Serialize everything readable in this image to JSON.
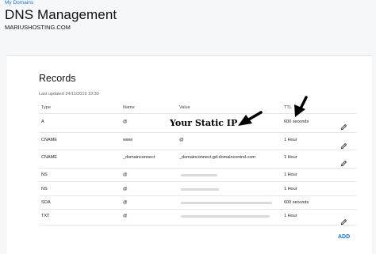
{
  "breadcrumb": "My Domains",
  "title": "DNS Management",
  "domain": "MARIUSHOSTING.COM",
  "records": {
    "heading": "Records",
    "last_updated": "Last updated 24/11/2019 19:30",
    "columns": {
      "type": "Type",
      "name": "Name",
      "value": "Value",
      "ttl": "TTL"
    },
    "rows": [
      {
        "type": "A",
        "name": "@",
        "value": "",
        "ttl": "600 seconds",
        "editable": true
      },
      {
        "type": "CNAME",
        "name": "www",
        "value": "@",
        "ttl": "1 Hour",
        "editable": true
      },
      {
        "type": "CNAME",
        "name": "_domainconnect",
        "value": "_domainconnect.gd.domaincontrol.com",
        "ttl": "1 Hour",
        "editable": true
      },
      {
        "type": "NS",
        "name": "@",
        "value": "",
        "ttl": "1 Hour",
        "editable": false
      },
      {
        "type": "NS",
        "name": "@",
        "value": "",
        "ttl": "1 Hour",
        "editable": false
      },
      {
        "type": "SOA",
        "name": "@",
        "value": "",
        "ttl": "600 seconds",
        "editable": false
      },
      {
        "type": "TXT",
        "name": "@",
        "value": "",
        "ttl": "1 Hour",
        "editable": true
      }
    ]
  },
  "add_label": "ADD",
  "annotation": "Your Static IP",
  "colors": {
    "accent": "#1976d2"
  },
  "icons": {
    "edit": "pencil-icon",
    "arrow": "arrow-icon"
  }
}
